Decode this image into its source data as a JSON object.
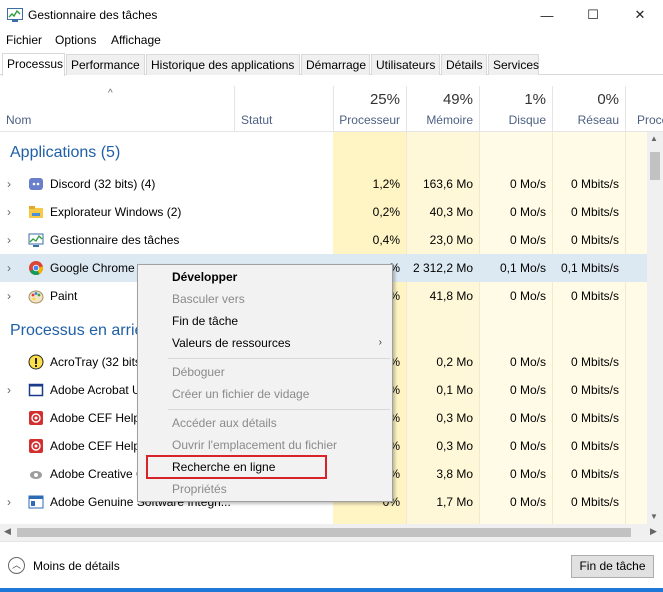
{
  "window": {
    "title": "Gestionnaire des tâches",
    "min_glyph": "—",
    "max_glyph": "☐",
    "close_glyph": "✕"
  },
  "menu": [
    "Fichier",
    "Options",
    "Affichage"
  ],
  "tabs": [
    "Processus",
    "Performance",
    "Historique des applications",
    "Démarrage",
    "Utilisateurs",
    "Détails",
    "Services"
  ],
  "active_tab": "Processus",
  "columns": {
    "name": "Nom",
    "status": "Statut",
    "cpu": {
      "pct": "25%",
      "label": "Processeur"
    },
    "memory": {
      "pct": "49%",
      "label": "Mémoire"
    },
    "disk": {
      "pct": "1%",
      "label": "Disque"
    },
    "network": {
      "pct": "0%",
      "label": "Réseau"
    },
    "power": {
      "label": "Proce"
    }
  },
  "groups": {
    "apps": "Applications (5)",
    "background": "Processus en arriè"
  },
  "app_rows": [
    {
      "name": "Discord (32 bits) (4)",
      "cpu": "1,2%",
      "mem": "163,6 Mo",
      "disk": "0 Mo/s",
      "net": "0 Mbits/s",
      "icon": "discord-icon",
      "expandable": true
    },
    {
      "name": "Explorateur Windows (2)",
      "cpu": "0,2%",
      "mem": "40,3 Mo",
      "disk": "0 Mo/s",
      "net": "0 Mbits/s",
      "icon": "folder-icon",
      "expandable": true
    },
    {
      "name": "Gestionnaire des tâches",
      "cpu": "0,4%",
      "mem": "23,0 Mo",
      "disk": "0 Mo/s",
      "net": "0 Mbits/s",
      "icon": "task-manager-icon",
      "expandable": true
    },
    {
      "name": "Google Chrome",
      "cpu": "%",
      "mem": "2 312,2 Mo",
      "disk": "0,1 Mo/s",
      "net": "0,1 Mbits/s",
      "icon": "chrome-icon",
      "expandable": true,
      "selected": true
    },
    {
      "name": "Paint",
      "cpu": "%",
      "mem": "41,8 Mo",
      "disk": "0 Mo/s",
      "net": "0 Mbits/s",
      "icon": "paint-icon",
      "expandable": true
    }
  ],
  "bg_rows": [
    {
      "name": "AcroTray (32 bits",
      "cpu": "%",
      "mem": "0,2 Mo",
      "disk": "0 Mo/s",
      "net": "0 Mbits/s",
      "icon": "acrotray-icon",
      "expandable": false
    },
    {
      "name": "Adobe Acrobat U",
      "cpu": "%",
      "mem": "0,1 Mo",
      "disk": "0 Mo/s",
      "net": "0 Mbits/s",
      "icon": "acrobat-icon",
      "expandable": true
    },
    {
      "name": "Adobe CEF Help",
      "cpu": "%",
      "mem": "0,3 Mo",
      "disk": "0 Mo/s",
      "net": "0 Mbits/s",
      "icon": "adobe-cef-icon",
      "expandable": false
    },
    {
      "name": "Adobe CEF Help",
      "cpu": "%",
      "mem": "0,3 Mo",
      "disk": "0 Mo/s",
      "net": "0 Mbits/s",
      "icon": "adobe-cef-icon",
      "expandable": false
    },
    {
      "name": "Adobe Creative C",
      "cpu": "%",
      "mem": "3,8 Mo",
      "disk": "0 Mo/s",
      "net": "0 Mbits/s",
      "icon": "creative-cloud-icon",
      "expandable": false
    },
    {
      "name": "Adobe Genuine Software Integri...",
      "cpu": "0%",
      "mem": "1,7 Mo",
      "disk": "0 Mo/s",
      "net": "0 Mbits/s",
      "icon": "adobe-genuine-icon",
      "expandable": true
    }
  ],
  "context_menu": [
    {
      "label": "Développer",
      "bold": true,
      "disabled": false
    },
    {
      "label": "Basculer vers",
      "bold": false,
      "disabled": true
    },
    {
      "label": "Fin de tâche",
      "bold": false,
      "disabled": false
    },
    {
      "label": "Valeurs de ressources",
      "bold": false,
      "disabled": false,
      "submenu": true
    },
    {
      "label": "Déboguer",
      "bold": false,
      "disabled": true
    },
    {
      "label": "Créer un fichier de vidage",
      "bold": false,
      "disabled": true
    },
    {
      "label": "Accéder aux détails",
      "bold": false,
      "disabled": true
    },
    {
      "label": "Ouvrir l'emplacement du fichier",
      "bold": false,
      "disabled": true
    },
    {
      "label": "Recherche en ligne",
      "bold": false,
      "disabled": false,
      "highlighted": true
    },
    {
      "label": "Propriétés",
      "bold": false,
      "disabled": true
    }
  ],
  "footer": {
    "less_details": "Moins de détails",
    "end_task": "Fin de tâche"
  },
  "colors": {
    "accent": "#1e78d7",
    "cpu_highlight": "#fff4c4",
    "selected_row": "#dde9f2",
    "group_title": "#1f5fa6",
    "annotation": "#d9232a"
  }
}
